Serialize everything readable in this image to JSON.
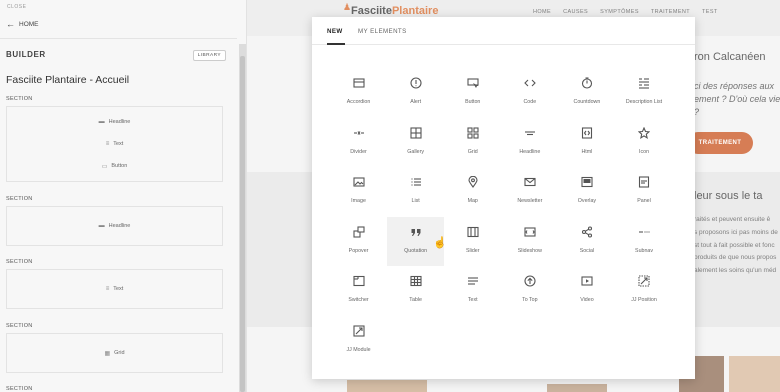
{
  "panel": {
    "close_label": "CLOSE",
    "home_label": "HOME",
    "builder_title": "BUILDER",
    "library_label": "LIBRARY",
    "page_title": "Fasciite Plantaire - Accueil",
    "sections": [
      {
        "label": "SECTION",
        "items": [
          {
            "icon": "headline-icon",
            "label": "Headline"
          },
          {
            "icon": "text-icon",
            "label": "Text"
          },
          {
            "icon": "button-icon",
            "label": "Button"
          }
        ]
      },
      {
        "label": "SECTION",
        "items": [
          {
            "icon": "headline-icon",
            "label": "Headline"
          }
        ]
      },
      {
        "label": "SECTION",
        "items": [
          {
            "icon": "text-icon",
            "label": "Text"
          }
        ]
      },
      {
        "label": "SECTION",
        "items": [
          {
            "icon": "grid-icon",
            "label": "Grid"
          }
        ]
      },
      {
        "label": "SECTION",
        "items": []
      }
    ]
  },
  "site": {
    "logo_part1": "Fasciite",
    "logo_part2": "Plantaire",
    "nav": [
      "HOME",
      "CAUSES",
      "SYMPTÔMES",
      "TRAITEMENT",
      "TEST"
    ],
    "hero_title": "ron Calcanéen",
    "hero_q1": "ci des réponses aux",
    "hero_q2": "ement ? D'où cela vie",
    "hero_q3": "?",
    "cta_label": "TRAITEMENT",
    "sub_title": "leur sous le ta",
    "para_lines": [
      "raités et peuvent ensuite ê",
      "s proposons ici pas moins de",
      "st tout à fait possible et fonc",
      "produits de que nous propos",
      "alement les soins qu'un méd"
    ]
  },
  "modal": {
    "tabs": [
      "NEW",
      "MY ELEMENTS"
    ],
    "active_tab": "NEW",
    "hovered": "Quotation",
    "elements": [
      {
        "label": "Accordion",
        "icon": "accordion-icon"
      },
      {
        "label": "Alert",
        "icon": "alert-icon"
      },
      {
        "label": "Button",
        "icon": "button-icon"
      },
      {
        "label": "Code",
        "icon": "code-icon"
      },
      {
        "label": "Countdown",
        "icon": "countdown-icon"
      },
      {
        "label": "Description List",
        "icon": "description-list-icon"
      },
      {
        "label": "Divider",
        "icon": "divider-icon"
      },
      {
        "label": "Gallery",
        "icon": "gallery-icon"
      },
      {
        "label": "Grid",
        "icon": "grid-icon"
      },
      {
        "label": "Headline",
        "icon": "headline-icon"
      },
      {
        "label": "Html",
        "icon": "html-icon"
      },
      {
        "label": "Icon",
        "icon": "star-icon"
      },
      {
        "label": "Image",
        "icon": "image-icon"
      },
      {
        "label": "List",
        "icon": "list-icon"
      },
      {
        "label": "Map",
        "icon": "map-pin-icon"
      },
      {
        "label": "Newsletter",
        "icon": "envelope-icon"
      },
      {
        "label": "Overlay",
        "icon": "overlay-icon"
      },
      {
        "label": "Panel",
        "icon": "panel-icon"
      },
      {
        "label": "Popover",
        "icon": "popover-icon"
      },
      {
        "label": "Quotation",
        "icon": "quotation-icon"
      },
      {
        "label": "Slider",
        "icon": "slider-icon"
      },
      {
        "label": "Slideshow",
        "icon": "slideshow-icon"
      },
      {
        "label": "Social",
        "icon": "share-icon"
      },
      {
        "label": "Subnav",
        "icon": "subnav-icon"
      },
      {
        "label": "Switcher",
        "icon": "switcher-icon"
      },
      {
        "label": "Table",
        "icon": "table-icon"
      },
      {
        "label": "Text",
        "icon": "text-icon"
      },
      {
        "label": "To Top",
        "icon": "to-top-icon"
      },
      {
        "label": "Video",
        "icon": "video-icon"
      },
      {
        "label": "JJ Position",
        "icon": "position-icon"
      },
      {
        "label": "JJ Module",
        "icon": "module-icon"
      }
    ]
  },
  "colors": {
    "accent": "#c8521c",
    "logo_accent": "#d96a2b"
  }
}
